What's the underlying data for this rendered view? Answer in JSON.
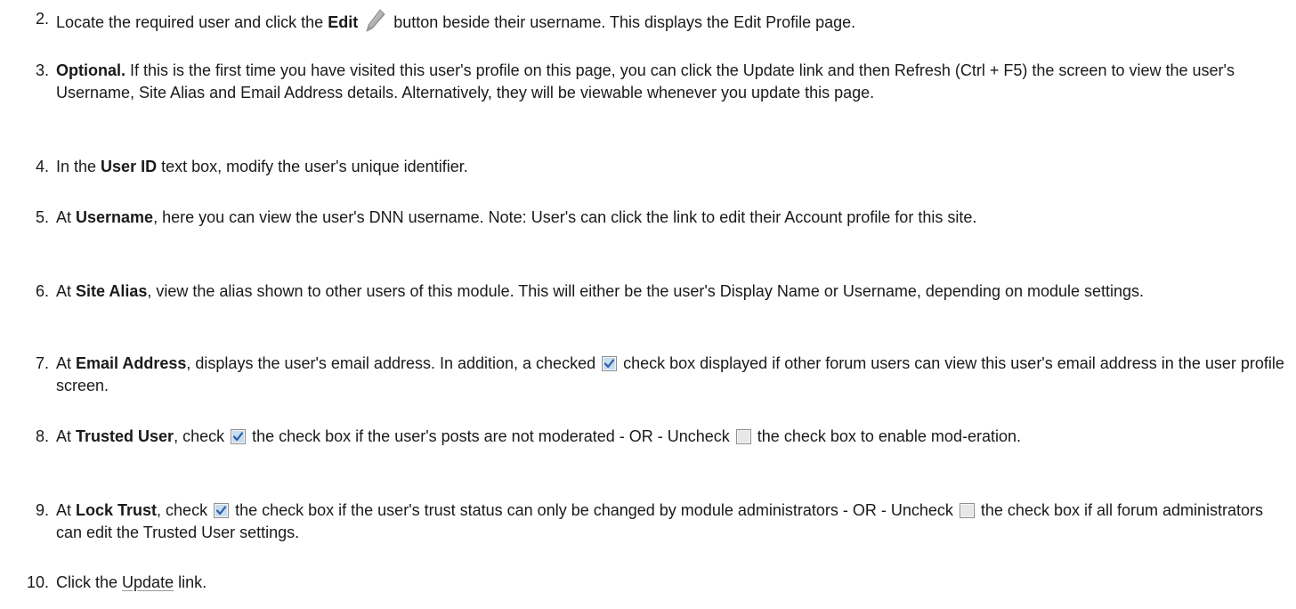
{
  "steps": [
    {
      "number": "2.",
      "parts": [
        {
          "t": "Locate the required user and click the "
        },
        {
          "t": "Edit",
          "b": true
        },
        {
          "icon": "pencil",
          "name": "edit-pencil-icon"
        },
        {
          "t": "button beside their username. This displays the Edit Profile page."
        }
      ]
    },
    {
      "number": "3.",
      "parts": [
        {
          "t": "Optional.",
          "b": true
        },
        {
          "t": " If this is the first time you have visited this user's profile on this page, you can click the Update link and then Refresh (Ctrl + F5) the screen to view the user's Username, Site Alias and Email Address details. Alternatively, they will be viewable whenever you update this page."
        }
      ]
    },
    {
      "number": "4.",
      "parts": [
        {
          "t": "In the "
        },
        {
          "t": "User ID",
          "b": true
        },
        {
          "t": " text box, modify the user's unique identifier."
        }
      ]
    },
    {
      "number": "5.",
      "parts": [
        {
          "t": "At "
        },
        {
          "t": "Username",
          "b": true
        },
        {
          "t": ", here you can view the user's DNN username. Note: User's can click the link to edit their Account profile for this site."
        }
      ]
    },
    {
      "number": "6.",
      "parts": [
        {
          "t": "At "
        },
        {
          "t": "Site Alias",
          "b": true
        },
        {
          "t": ", view the alias shown to other users of this module. This will either be the user's Display Name or Username, depending on module settings."
        }
      ]
    },
    {
      "number": "7.",
      "parts": [
        {
          "t": "At "
        },
        {
          "t": "Email Address",
          "b": true
        },
        {
          "t": ", displays the user's email address. In addition, a checked "
        },
        {
          "icon": "checked",
          "name": "checked-checkbox-icon"
        },
        {
          "t": " check box displayed if other forum users can view this user's email address in the user profile screen."
        }
      ]
    },
    {
      "number": "8.",
      "parts": [
        {
          "t": "At "
        },
        {
          "t": "Trusted User",
          "b": true
        },
        {
          "t": ", check "
        },
        {
          "icon": "checked",
          "name": "checked-checkbox-icon"
        },
        {
          "t": " the check box if the user's posts are not moderated - OR - Uncheck "
        },
        {
          "icon": "unchecked",
          "name": "unchecked-checkbox-icon"
        },
        {
          "t": " the check box to enable mod-eration."
        }
      ]
    },
    {
      "number": "9.",
      "parts": [
        {
          "t": "At "
        },
        {
          "t": "Lock Trust",
          "b": true
        },
        {
          "t": ", check "
        },
        {
          "icon": "checked",
          "name": "checked-checkbox-icon"
        },
        {
          "t": " the check box if the user's trust status can only be changed by module administrators - OR - Uncheck "
        },
        {
          "icon": "unchecked",
          "name": "unchecked-checkbox-icon"
        },
        {
          "t": " the check box if all forum administrators can edit the Trusted User settings."
        }
      ]
    },
    {
      "number": "10.",
      "parts": [
        {
          "t": "Click the "
        },
        {
          "t": "Update",
          "link": true
        },
        {
          "t": " link."
        }
      ]
    }
  ]
}
